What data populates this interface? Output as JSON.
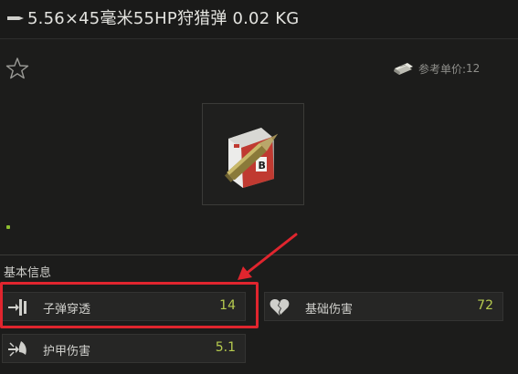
{
  "title": {
    "text": "5.56×45毫米55HP狩猎弹 0.02 KG"
  },
  "price": {
    "label": "参考单价:",
    "value": "12"
  },
  "section": {
    "title": "基本信息"
  },
  "stats": [
    {
      "label": "子弹穿透",
      "value": "14",
      "icon": "penetration-icon"
    },
    {
      "label": "基础伤害",
      "value": "72",
      "icon": "broken-heart-icon"
    },
    {
      "label": "护甲伤害",
      "value": "5.1",
      "icon": "armor-damage-icon"
    }
  ],
  "annotation": {
    "color": "#e0252e"
  },
  "colors": {
    "accent_value": "#b7cc4f",
    "background": "#1c1c1b",
    "dot": "#8dbd2f"
  }
}
